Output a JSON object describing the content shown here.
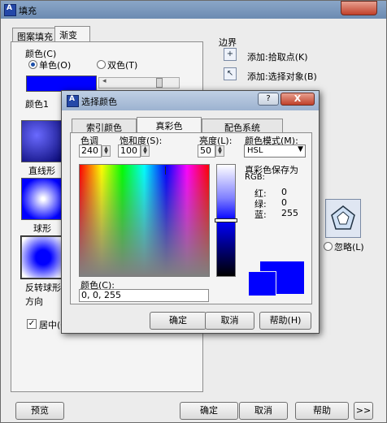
{
  "outer": {
    "title": "填充",
    "tabs": [
      "图案填充",
      "渐变色"
    ],
    "color_group_label": "颜色(C)",
    "radio_single": "单色(O)",
    "radio_double": "双色(T)",
    "color1_label": "颜色1",
    "gradient_labels": [
      "直线形",
      "球形",
      "反转球形"
    ],
    "direction_label": "方向",
    "center_label": "居中(C)",
    "boundary_label": "边界",
    "add_pick_points": "添加:拾取点(K)",
    "add_select_objects": "添加:选择对象(B)",
    "ignore_label": "忽略(L)",
    "buttons": {
      "preview": "预览",
      "ok": "确定",
      "cancel": "取消",
      "help": "帮助",
      "more": ">>"
    }
  },
  "dialog": {
    "title": "选择颜色",
    "help_glyph": "?",
    "close_glyph": "X",
    "tabs": [
      "索引颜色",
      "真彩色",
      "配色系统"
    ],
    "hue_label": "色调",
    "hue_value": "240",
    "sat_label": "饱和度(S):",
    "sat_value": "100",
    "lum_label": "亮度(L):",
    "lum_value": "50",
    "mode_label": "颜色模式(M):",
    "mode_value": "HSL",
    "saved_as": "真彩色保存为",
    "rgb_label": "RGB:",
    "red_label": "红:",
    "red_value": "0",
    "green_label": "绿:",
    "green_value": "0",
    "blue_label": "蓝:",
    "blue_value": "255",
    "color_field_label": "颜色(C):",
    "color_field_value": "0, 0, 255",
    "ok": "确定",
    "cancel": "取消",
    "help": "帮助(H)"
  },
  "colors": {
    "selected": "#0000ff",
    "title_bar": "#7a96bd"
  }
}
